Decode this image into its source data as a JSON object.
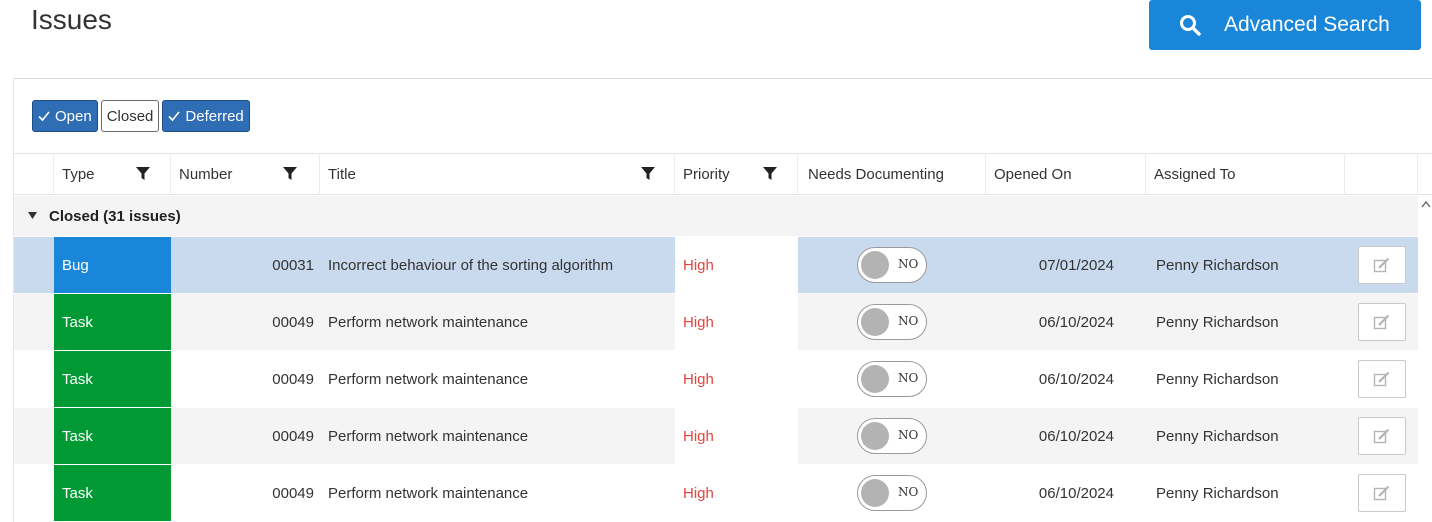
{
  "page": {
    "title": "Issues"
  },
  "toolbar": {
    "advanced_search_label": "Advanced Search"
  },
  "filters": [
    {
      "label": "Open",
      "checked": true
    },
    {
      "label": "Closed",
      "checked": false
    },
    {
      "label": "Deferred",
      "checked": true
    }
  ],
  "columns": {
    "type": "Type",
    "number": "Number",
    "title": "Title",
    "priority": "Priority",
    "needs_documenting": "Needs Documenting",
    "opened_on": "Opened On",
    "assigned_to": "Assigned To"
  },
  "group": {
    "label": "Closed (31 issues)"
  },
  "rows": [
    {
      "type": "Bug",
      "number": "00031",
      "title": "Incorrect behaviour of the sorting algorithm",
      "priority": "High",
      "needs_documenting": "NO",
      "opened_on": "07/01/2024",
      "assigned_to": "Penny Richardson",
      "selected": true
    },
    {
      "type": "Task",
      "number": "00049",
      "title": "Perform network maintenance",
      "priority": "High",
      "needs_documenting": "NO",
      "opened_on": "06/10/2024",
      "assigned_to": "Penny Richardson",
      "selected": false
    },
    {
      "type": "Task",
      "number": "00049",
      "title": "Perform network maintenance",
      "priority": "High",
      "needs_documenting": "NO",
      "opened_on": "06/10/2024",
      "assigned_to": "Penny Richardson",
      "selected": false
    },
    {
      "type": "Task",
      "number": "00049",
      "title": "Perform network maintenance",
      "priority": "High",
      "needs_documenting": "NO",
      "opened_on": "06/10/2024",
      "assigned_to": "Penny Richardson",
      "selected": false
    },
    {
      "type": "Task",
      "number": "00049",
      "title": "Perform network maintenance",
      "priority": "High",
      "needs_documenting": "NO",
      "opened_on": "06/10/2024",
      "assigned_to": "Penny Richardson",
      "selected": false
    }
  ],
  "colors": {
    "accent": "#1a86d9",
    "filter_on": "#2f6db5",
    "bug": "#1a86d9",
    "task": "#009933",
    "priority_high": "#e2453c",
    "selected_row": "#c9daee",
    "alt_row": "#f4f4f4"
  },
  "icons": {
    "search": "search-icon",
    "filter": "filter-icon",
    "edit": "edit-icon",
    "check": "check-icon",
    "caret": "caret-down-icon"
  }
}
